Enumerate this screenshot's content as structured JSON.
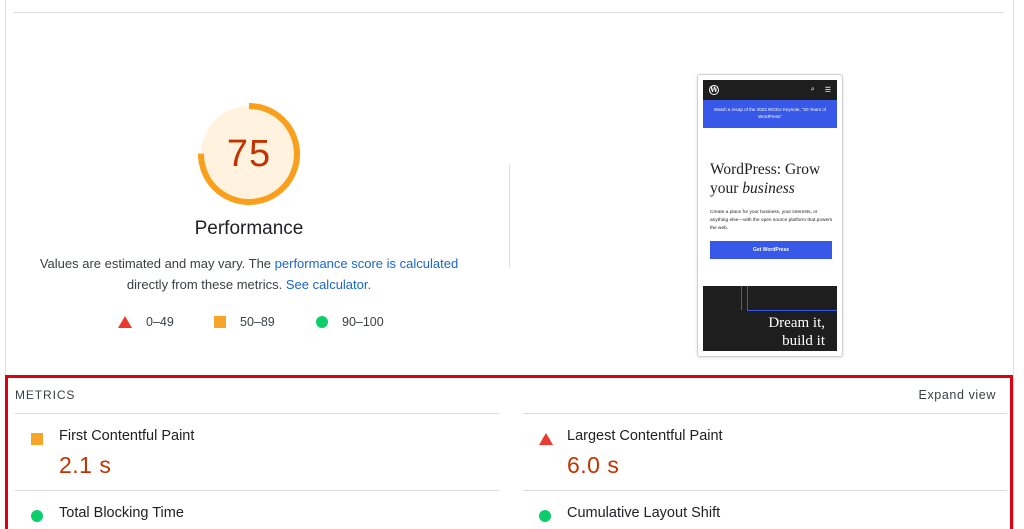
{
  "score": {
    "value": 75,
    "fraction": 0.75,
    "title": "Performance",
    "color": "#fa9f1c",
    "text_color": "#c33300"
  },
  "description": {
    "text1": "Values are estimated and may vary. The ",
    "link1": "performance score is calculated",
    "text2": " directly from these metrics. ",
    "link2": "See calculator."
  },
  "legend": [
    {
      "shape": "triangle",
      "range": "0–49",
      "color": "#eb3a2f"
    },
    {
      "shape": "square",
      "range": "50–89",
      "color": "#f6a42a"
    },
    {
      "shape": "circle",
      "range": "90–100",
      "color": "#0cce6b"
    }
  ],
  "screenshot": {
    "banner": "Watch a recap of the 2023 WCEU Keynote, \"20 Years of WordPress\"",
    "title_line1": "WordPress: Grow",
    "title_line2_prefix": "your ",
    "title_line2_em": "business",
    "body": "Create a place for your business, your interests, or anything else—with the open source platform that powers the web.",
    "button": "Get WordPress",
    "dark_line1": "Dream it,",
    "dark_line2": "build it"
  },
  "metrics": {
    "label": "METRICS",
    "expand": "Expand view",
    "items": [
      {
        "name": "First Contentful Paint",
        "value": "2.1 s",
        "status": "average"
      },
      {
        "name": "Largest Contentful Paint",
        "value": "6.0 s",
        "status": "fail"
      },
      {
        "name": "Total Blocking Time",
        "value": "",
        "status": "pass"
      },
      {
        "name": "Cumulative Layout Shift",
        "value": "",
        "status": "pass"
      }
    ]
  }
}
